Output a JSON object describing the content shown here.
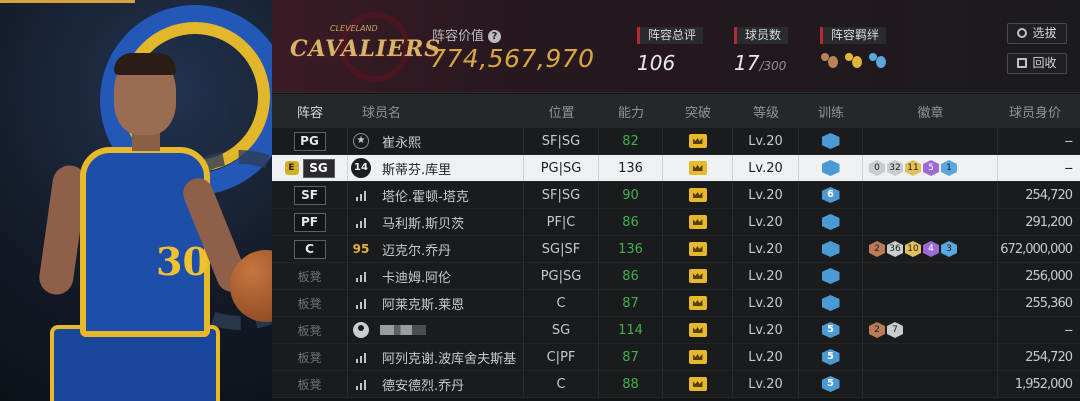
{
  "header": {
    "team_logo_text": "CAVALIERS",
    "team_logo_sub": "CLEVELAND",
    "value_label": "阵容价值",
    "value": "774,567,970",
    "stats": [
      {
        "label": "阵容总评",
        "value": "106",
        "suffix": ""
      },
      {
        "label": "球员数",
        "value": "17",
        "suffix": "/300"
      },
      {
        "label": "阵容羁绊",
        "value": "",
        "suffix": ""
      }
    ],
    "buttons": {
      "select": "选拔",
      "recycle": "回收"
    }
  },
  "columns": [
    "阵容",
    "球员名",
    "位置",
    "能力",
    "突破",
    "等级",
    "训练",
    "徽章",
    "球员身价"
  ],
  "rows": [
    {
      "slot": "PG",
      "icon": "star",
      "name": "崔永熙",
      "position": "SF|SG",
      "ability": "82",
      "ability_color": "green",
      "level": "Lv.20",
      "train": "",
      "badges": [],
      "price": "--"
    },
    {
      "slot": "SG",
      "icon": "14",
      "name": "斯蒂芬.库里",
      "position": "PG|SG",
      "ability": "136",
      "ability_color": "dark",
      "level": "Lv.20",
      "train": "",
      "badges": [
        "0",
        "32",
        "11",
        "5",
        "1"
      ],
      "price": "--"
    },
    {
      "slot": "SF",
      "icon": "bars",
      "name": "塔伦.霍顿-塔克",
      "position": "SF|SG",
      "ability": "90",
      "ability_color": "green",
      "level": "Lv.20",
      "train": "6",
      "badges": [],
      "price": "254,720"
    },
    {
      "slot": "PF",
      "icon": "bars",
      "name": "马利斯.斯贝茨",
      "position": "PF|C",
      "ability": "86",
      "ability_color": "green",
      "level": "Lv.20",
      "train": "",
      "badges": [],
      "price": "291,200"
    },
    {
      "slot": "C",
      "icon": "95",
      "name": "迈克尔.乔丹",
      "position": "SG|SF",
      "ability": "136",
      "ability_color": "green",
      "level": "Lv.20",
      "train": "",
      "badges": [
        "2",
        "36",
        "10",
        "4",
        "3"
      ],
      "price": "672,000,000"
    },
    {
      "slot": "板凳",
      "icon": "bars",
      "name": "卡迪姆.阿伦",
      "position": "PG|SG",
      "ability": "86",
      "ability_color": "green",
      "level": "Lv.20",
      "train": "",
      "badges": [],
      "price": "256,000"
    },
    {
      "slot": "板凳",
      "icon": "bars",
      "name": "阿莱克斯.莱恩",
      "position": "C",
      "ability": "87",
      "ability_color": "green",
      "level": "Lv.20",
      "train": "",
      "badges": [],
      "price": "255,360"
    },
    {
      "slot": "板凳",
      "icon": "avatar",
      "name": "",
      "position": "SG",
      "ability": "114",
      "ability_color": "green",
      "level": "Lv.20",
      "train": "5",
      "badges": [
        "2",
        "7"
      ],
      "price": "--"
    },
    {
      "slot": "板凳",
      "icon": "bars",
      "name": "阿列克谢.波库舍夫斯基",
      "position": "C|PF",
      "ability": "87",
      "ability_color": "green",
      "level": "Lv.20",
      "train": "5",
      "badges": [],
      "price": "254,720"
    },
    {
      "slot": "板凳",
      "icon": "bars",
      "name": "德安德烈.乔丹",
      "position": "C",
      "ability": "88",
      "ability_color": "green",
      "level": "Lv.20",
      "train": "5",
      "badges": [],
      "price": "1,952,000"
    }
  ],
  "selected_marker": "E"
}
